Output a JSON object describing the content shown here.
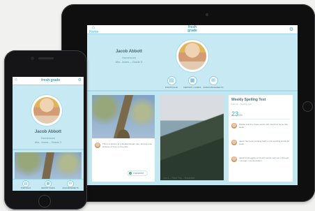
{
  "app": {
    "logo_text": "Jacob Abbott"
  },
  "tablet": {
    "topbar": {
      "home_label": "Home",
      "logo": "fresh grade"
    },
    "profile": {
      "name": "Jacob Abbott",
      "role": "Homeroom",
      "class": "Mrs. Jones – Grade 3"
    },
    "nav": [
      {
        "label": "Portfolio",
        "icon": "portfolio-icon"
      },
      {
        "label": "Report Cards",
        "icon": "report-card-icon"
      },
      {
        "label": "Announcements",
        "icon": "announcement-icon"
      }
    ],
    "tree_card": {
      "comment_text": "This is a picture of a Mediterranean tree, and we took pictures of trees in the park...",
      "comment_date": "Feb 14",
      "comment_button": "Comment"
    },
    "cliff_card": {
      "caption": "Jan 4 – Field Trip – Estuaries"
    },
    "spelling_card": {
      "title": "Weekly Spelling Test",
      "meta": "Feb 13 – Spelling test",
      "score": "23",
      "score_total": "/25",
      "comments": [
        {
          "text": "Please practice these words with Jacob at home this week.",
          "date": "Feb 13"
        },
        {
          "text": "Jacob has been working hard on his spelling words all week.",
          "date": "Feb 14"
        },
        {
          "text": "Jacob is struggling a bit with words such as: • through • enough • pronunciation",
          "date": "Feb 15"
        }
      ]
    }
  },
  "phone": {
    "profile": {
      "name": "Jacob Abbott",
      "role": "Homeroom",
      "class": "Mrs. Jones – Grade 3"
    },
    "nav": [
      {
        "label": "Portfolio"
      },
      {
        "label": "Report Cards"
      },
      {
        "label": "Announcements"
      }
    ]
  }
}
